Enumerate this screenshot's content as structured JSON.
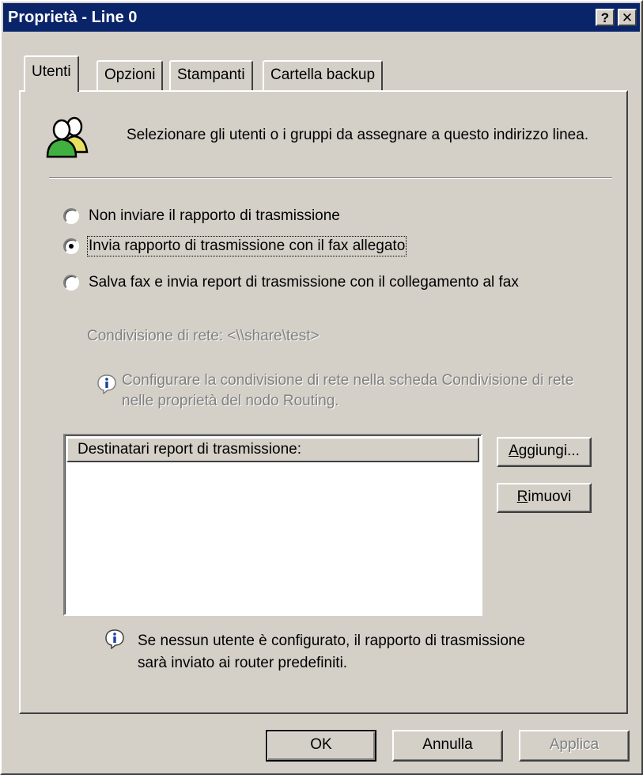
{
  "window": {
    "title": "Proprietà - Line 0",
    "help_glyph": "?",
    "close_glyph": "✕"
  },
  "tabs": [
    {
      "label": "Utenti",
      "active": true
    },
    {
      "label": "Opzioni",
      "active": false
    },
    {
      "label": "Stampanti",
      "active": false
    },
    {
      "label": "Cartella backup",
      "active": false
    }
  ],
  "intro": {
    "icon": "users-icon",
    "text": "Selezionare gli utenti o i gruppi da assegnare a questo indirizzo linea."
  },
  "radios": [
    {
      "label": "Non inviare il rapporto di trasmissione",
      "checked": false
    },
    {
      "label": "Invia rapporto di trasmissione con il fax allegato",
      "checked": true
    },
    {
      "label": "Salva fax e invia report di trasmissione con il collegamento al fax",
      "checked": false
    }
  ],
  "share": {
    "label": "Condivisione di rete: <\\\\share\\test>"
  },
  "share_info": {
    "icon": "info-icon",
    "text": "Configurare la condivisione di rete nella scheda Condivisione di rete nelle proprietà del nodo Routing."
  },
  "recipients": {
    "header": "Destinatari report di trasmissione:",
    "items": []
  },
  "side_buttons": {
    "add_prefix": "A",
    "add_rest": "ggiungi...",
    "remove_prefix": "R",
    "remove_rest": "imuovi"
  },
  "footer_info": {
    "icon": "info-icon",
    "text": "Se nessun utente è configurato, il rapporto di trasmissione sarà inviato ai router predefiniti."
  },
  "footer_buttons": {
    "ok": "OK",
    "cancel": "Annulla",
    "apply": "Applica"
  },
  "colors": {
    "titlebar": "#0a246a",
    "face": "#d4d0c8",
    "disabled_text": "#808080"
  }
}
